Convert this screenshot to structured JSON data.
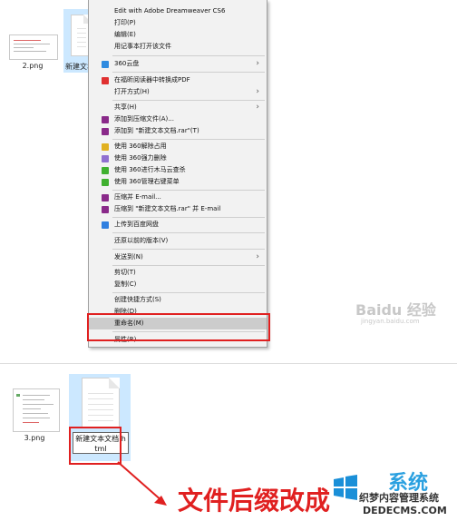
{
  "top_files": {
    "file1": "2.png",
    "file2": "新建文本文"
  },
  "menu": {
    "items": [
      {
        "label": "Edit with Adobe Dreamweaver CS6",
        "icon": "none"
      },
      {
        "label": "打印(P)",
        "icon": "none"
      },
      {
        "label": "编辑(E)",
        "icon": "none"
      },
      {
        "label": "用记事本打开该文件",
        "icon": "none"
      },
      {
        "label": "360云盘",
        "icon": "cloud-360-icon"
      },
      {
        "label": "在福昕阅读器中转换成PDF",
        "icon": "pdf-icon"
      },
      {
        "label": "打开方式(H)",
        "icon": "none"
      },
      {
        "label": "共享(H)",
        "icon": "none"
      },
      {
        "label": "添加到压缩文件(A)...",
        "icon": "winrar-icon"
      },
      {
        "label": "添加到 \"新建文本文档.rar\"(T)",
        "icon": "winrar-icon"
      },
      {
        "label": "使用 360解除占用",
        "icon": "unlock-360-icon"
      },
      {
        "label": "使用 360强力删除",
        "icon": "delete-360-icon"
      },
      {
        "label": "使用 360进行木马云查杀",
        "icon": "scan-360-icon"
      },
      {
        "label": "使用 360管理右键菜单",
        "icon": "manage-360-icon"
      },
      {
        "label": "压缩并 E-mail...",
        "icon": "winrar-icon"
      },
      {
        "label": "压缩到 \"新建文本文档.rar\" 并 E-mail",
        "icon": "winrar-icon"
      },
      {
        "label": "上传到百度网盘",
        "icon": "baidu-pan-icon"
      },
      {
        "label": "还原以前的版本(V)",
        "icon": "none"
      },
      {
        "label": "发送到(N)",
        "icon": "none"
      },
      {
        "label": "剪切(T)",
        "icon": "none"
      },
      {
        "label": "复制(C)",
        "icon": "none"
      },
      {
        "label": "创建快捷方式(S)",
        "icon": "none"
      },
      {
        "label": "删除(D)",
        "icon": "none"
      },
      {
        "label": "重命名(M)",
        "icon": "none"
      },
      {
        "label": "属性(R)",
        "icon": "none"
      }
    ],
    "submenu_arrow": "›",
    "highlight_color": "#cccccc"
  },
  "watermark": {
    "text": "Baidu 经验",
    "url": "jingyan.baidu.com"
  },
  "bottom_files": {
    "file1": "3.png",
    "rename_value": "新建文本文档.html"
  },
  "annotation": {
    "text": "文件后缀改成",
    "color": "#e02020"
  },
  "site_logo": {
    "text1": "系统",
    "text2": "织梦内容管理系统",
    "text3": "DEDECMS.COM"
  },
  "colors": {
    "selection": "#cce8ff",
    "red": "#e02020"
  }
}
